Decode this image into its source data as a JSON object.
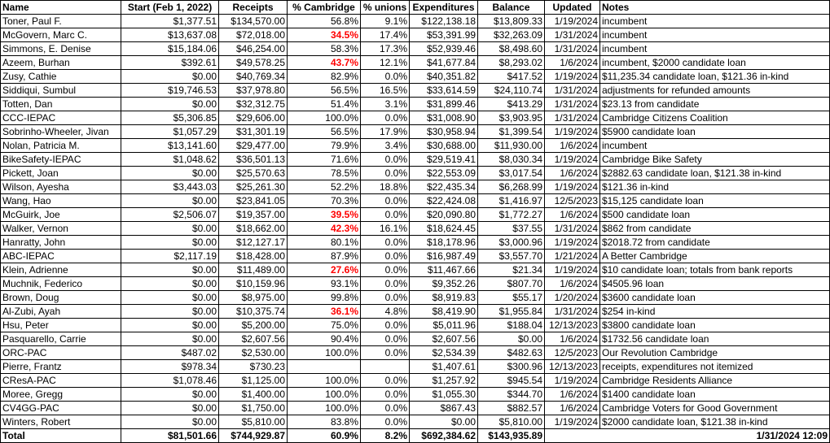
{
  "headers": [
    "Name",
    "Start (Feb 1, 2022)",
    "Receipts",
    "% Cambridge",
    "% unions",
    "Expenditures",
    "Balance",
    "Updated",
    "Notes"
  ],
  "rows": [
    {
      "name": "Toner, Paul F.",
      "start": "$1,377.51",
      "receipts": "$134,570.00",
      "cambridge": "56.8%",
      "cambridge_flag": false,
      "unions": "9.1%",
      "expenditures": "$122,138.18",
      "balance": "$13,809.33",
      "updated": "1/19/2024",
      "notes": "incumbent"
    },
    {
      "name": "McGovern, Marc C.",
      "start": "$13,637.08",
      "receipts": "$72,018.00",
      "cambridge": "34.5%",
      "cambridge_flag": true,
      "unions": "17.4%",
      "expenditures": "$53,391.99",
      "balance": "$32,263.09",
      "updated": "1/31/2024",
      "notes": "incumbent"
    },
    {
      "name": "Simmons, E. Denise",
      "start": "$15,184.06",
      "receipts": "$46,254.00",
      "cambridge": "58.3%",
      "cambridge_flag": false,
      "unions": "17.3%",
      "expenditures": "$52,939.46",
      "balance": "$8,498.60",
      "updated": "1/31/2024",
      "notes": "incumbent"
    },
    {
      "name": "Azeem, Burhan",
      "start": "$392.61",
      "receipts": "$49,578.25",
      "cambridge": "43.7%",
      "cambridge_flag": true,
      "unions": "12.1%",
      "expenditures": "$41,677.84",
      "balance": "$8,293.02",
      "updated": "1/6/2024",
      "notes": "incumbent, $2000 candidate loan"
    },
    {
      "name": "Zusy, Cathie",
      "start": "$0.00",
      "receipts": "$40,769.34",
      "cambridge": "82.9%",
      "cambridge_flag": false,
      "unions": "0.0%",
      "expenditures": "$40,351.82",
      "balance": "$417.52",
      "updated": "1/19/2024",
      "notes": "$11,235.34 candidate loan, $121.36 in-kind"
    },
    {
      "name": "Siddiqui, Sumbul",
      "start": "$19,746.53",
      "receipts": "$37,978.80",
      "cambridge": "56.5%",
      "cambridge_flag": false,
      "unions": "16.5%",
      "expenditures": "$33,614.59",
      "balance": "$24,110.74",
      "updated": "1/31/2024",
      "notes": "adjustments for refunded amounts"
    },
    {
      "name": "Totten, Dan",
      "start": "$0.00",
      "receipts": "$32,312.75",
      "cambridge": "51.4%",
      "cambridge_flag": false,
      "unions": "3.1%",
      "expenditures": "$31,899.46",
      "balance": "$413.29",
      "updated": "1/31/2024",
      "notes": "$23.13 from candidate"
    },
    {
      "name": "CCC-IEPAC",
      "start": "$5,306.85",
      "receipts": "$29,606.00",
      "cambridge": "100.0%",
      "cambridge_flag": false,
      "unions": "0.0%",
      "expenditures": "$31,008.90",
      "balance": "$3,903.95",
      "updated": "1/31/2024",
      "notes": "Cambridge Citizens Coalition"
    },
    {
      "name": "Sobrinho-Wheeler, Jivan",
      "start": "$1,057.29",
      "receipts": "$31,301.19",
      "cambridge": "56.5%",
      "cambridge_flag": false,
      "unions": "17.9%",
      "expenditures": "$30,958.94",
      "balance": "$1,399.54",
      "updated": "1/19/2024",
      "notes": "$5900 candidate loan"
    },
    {
      "name": "Nolan, Patricia M.",
      "start": "$13,141.60",
      "receipts": "$29,477.00",
      "cambridge": "79.9%",
      "cambridge_flag": false,
      "unions": "3.4%",
      "expenditures": "$30,688.00",
      "balance": "$11,930.00",
      "updated": "1/6/2024",
      "notes": "incumbent"
    },
    {
      "name": "BikeSafety-IEPAC",
      "start": "$1,048.62",
      "receipts": "$36,501.13",
      "cambridge": "71.6%",
      "cambridge_flag": false,
      "unions": "0.0%",
      "expenditures": "$29,519.41",
      "balance": "$8,030.34",
      "updated": "1/19/2024",
      "notes": "Cambridge Bike Safety"
    },
    {
      "name": "Pickett, Joan",
      "start": "$0.00",
      "receipts": "$25,570.63",
      "cambridge": "78.5%",
      "cambridge_flag": false,
      "unions": "0.0%",
      "expenditures": "$22,553.09",
      "balance": "$3,017.54",
      "updated": "1/6/2024",
      "notes": "$2882.63 candidate loan, $121.38 in-kind"
    },
    {
      "name": "Wilson, Ayesha",
      "start": "$3,443.03",
      "receipts": "$25,261.30",
      "cambridge": "52.2%",
      "cambridge_flag": false,
      "unions": "18.8%",
      "expenditures": "$22,435.34",
      "balance": "$6,268.99",
      "updated": "1/19/2024",
      "notes": " $121.36 in-kind"
    },
    {
      "name": "Wang, Hao",
      "start": "$0.00",
      "receipts": "$23,841.05",
      "cambridge": "70.3%",
      "cambridge_flag": false,
      "unions": "0.0%",
      "expenditures": "$22,424.08",
      "balance": "$1,416.97",
      "updated": "12/5/2023",
      "notes": "$15,125 candidate loan"
    },
    {
      "name": "McGuirk, Joe",
      "start": "$2,506.07",
      "receipts": "$19,357.00",
      "cambridge": "39.5%",
      "cambridge_flag": true,
      "unions": "0.0%",
      "expenditures": "$20,090.80",
      "balance": "$1,772.27",
      "updated": "1/6/2024",
      "notes": "$500 candidate loan"
    },
    {
      "name": "Walker, Vernon",
      "start": "$0.00",
      "receipts": "$18,662.00",
      "cambridge": "42.3%",
      "cambridge_flag": true,
      "unions": "16.1%",
      "expenditures": "$18,624.45",
      "balance": "$37.55",
      "updated": "1/31/2024",
      "notes": "$862 from candidate"
    },
    {
      "name": "Hanratty, John",
      "start": "$0.00",
      "receipts": "$12,127.17",
      "cambridge": "80.1%",
      "cambridge_flag": false,
      "unions": "0.0%",
      "expenditures": "$18,178.96",
      "balance": "$3,000.96",
      "updated": "1/19/2024",
      "notes": "$2018.72 from candidate"
    },
    {
      "name": "ABC-IEPAC",
      "start": "$2,117.19",
      "receipts": "$18,428.00",
      "cambridge": "87.9%",
      "cambridge_flag": false,
      "unions": "0.0%",
      "expenditures": "$16,987.49",
      "balance": "$3,557.70",
      "updated": "1/21/2024",
      "notes": "A Better Cambridge"
    },
    {
      "name": "Klein, Adrienne",
      "start": "$0.00",
      "receipts": "$11,489.00",
      "cambridge": "27.6%",
      "cambridge_flag": true,
      "unions": "0.0%",
      "expenditures": "$11,467.66",
      "balance": "$21.34",
      "updated": "1/19/2024",
      "notes": "$10 candidate loan; totals from bank reports"
    },
    {
      "name": "Muchnik, Federico",
      "start": "$0.00",
      "receipts": "$10,159.96",
      "cambridge": "93.1%",
      "cambridge_flag": false,
      "unions": "0.0%",
      "expenditures": "$9,352.26",
      "balance": "$807.70",
      "updated": "1/6/2024",
      "notes": "$4505.96 loan"
    },
    {
      "name": "Brown, Doug",
      "start": "$0.00",
      "receipts": "$8,975.00",
      "cambridge": "99.8%",
      "cambridge_flag": false,
      "unions": "0.0%",
      "expenditures": "$8,919.83",
      "balance": "$55.17",
      "updated": "1/20/2024",
      "notes": "$3600 candidate loan"
    },
    {
      "name": "Al-Zubi, Ayah",
      "start": "$0.00",
      "receipts": "$10,375.74",
      "cambridge": "36.1%",
      "cambridge_flag": true,
      "unions": "4.8%",
      "expenditures": "$8,419.90",
      "balance": "$1,955.84",
      "updated": "1/31/2024",
      "notes": "$254 in-kind"
    },
    {
      "name": "Hsu, Peter",
      "start": "$0.00",
      "receipts": "$5,200.00",
      "cambridge": "75.0%",
      "cambridge_flag": false,
      "unions": "0.0%",
      "expenditures": "$5,011.96",
      "balance": "$188.04",
      "updated": "12/13/2023",
      "notes": "$3800 candidate loan"
    },
    {
      "name": "Pasquarello, Carrie",
      "start": "$0.00",
      "receipts": "$2,607.56",
      "cambridge": "90.4%",
      "cambridge_flag": false,
      "unions": "0.0%",
      "expenditures": "$2,607.56",
      "balance": "$0.00",
      "updated": "1/6/2024",
      "notes": "$1732.56 candidate loan"
    },
    {
      "name": "ORC-PAC",
      "start": "$487.02",
      "receipts": "$2,530.00",
      "cambridge": "100.0%",
      "cambridge_flag": false,
      "unions": "0.0%",
      "expenditures": "$2,534.39",
      "balance": "$482.63",
      "updated": "12/5/2023",
      "notes": "Our Revolution Cambridge"
    },
    {
      "name": "Pierre, Frantz",
      "start": "$978.34",
      "receipts": "$730.23",
      "cambridge": "",
      "cambridge_flag": false,
      "unions": "",
      "expenditures": "$1,407.61",
      "balance": "$300.96",
      "updated": "12/13/2023",
      "notes": "receipts, expenditures not itemized"
    },
    {
      "name": "CResA-PAC",
      "start": "$1,078.46",
      "receipts": "$1,125.00",
      "cambridge": "100.0%",
      "cambridge_flag": false,
      "unions": "0.0%",
      "expenditures": "$1,257.92",
      "balance": "$945.54",
      "updated": "1/19/2024",
      "notes": "Cambridge Residents Alliance"
    },
    {
      "name": "Moree, Gregg",
      "start": "$0.00",
      "receipts": "$1,400.00",
      "cambridge": "100.0%",
      "cambridge_flag": false,
      "unions": "0.0%",
      "expenditures": "$1,055.30",
      "balance": "$344.70",
      "updated": "1/6/2024",
      "notes": "$1400 candidate loan"
    },
    {
      "name": "CV4GG-PAC",
      "start": "$0.00",
      "receipts": "$1,750.00",
      "cambridge": "100.0%",
      "cambridge_flag": false,
      "unions": "0.0%",
      "expenditures": "$867.43",
      "balance": "$882.57",
      "updated": "1/6/2024",
      "notes": "Cambridge Voters for Good Government"
    },
    {
      "name": "Winters, Robert",
      "start": "$0.00",
      "receipts": "$5,810.00",
      "cambridge": "83.8%",
      "cambridge_flag": false,
      "unions": "0.0%",
      "expenditures": "$0.00",
      "balance": "$5,810.00",
      "updated": "1/19/2024",
      "notes": "$2000 candidate loan, $121.38 in-kind"
    }
  ],
  "total": {
    "label": "Total",
    "start": "$81,501.66",
    "receipts": "$744,929.87",
    "cambridge": "60.9%",
    "unions": "8.2%",
    "expenditures": "$692,384.62",
    "balance": "$143,935.89",
    "timestamp": "1/31/2024 12:09"
  },
  "colors": {
    "flag": "#ff0000",
    "grid": "#000000",
    "background": "#ffffff"
  }
}
